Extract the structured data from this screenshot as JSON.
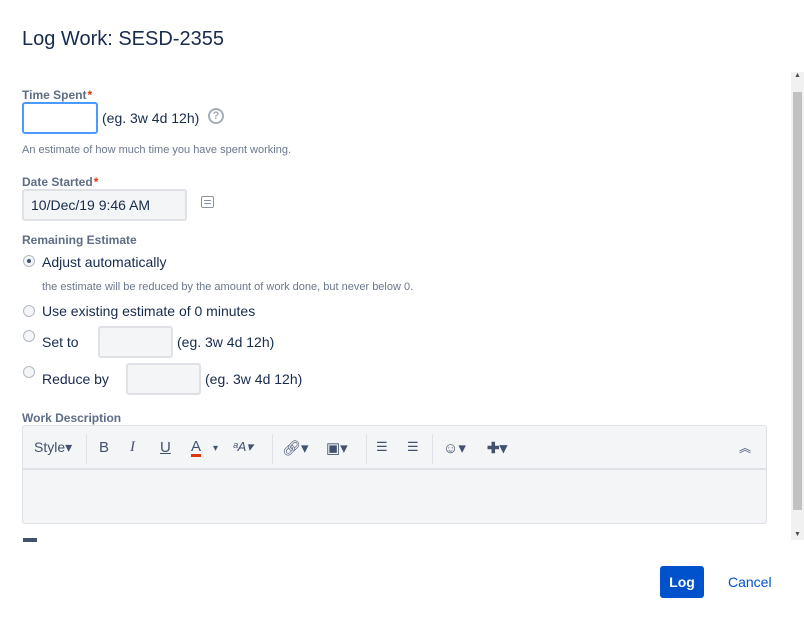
{
  "title": "Log Work: SESD-2355",
  "time_spent": {
    "label": "Time Spent",
    "required": "*",
    "value": "",
    "hint": "(eg. 3w 4d 12h)",
    "help": "An estimate of how much time you have spent working."
  },
  "date_started": {
    "label": "Date Started",
    "required": "*",
    "value": "10/Dec/19 9:46 AM"
  },
  "remaining": {
    "label": "Remaining Estimate",
    "options": [
      {
        "label": "Adjust automatically",
        "selected": true,
        "hint": "the estimate will be reduced by the amount of work done, but never below 0."
      },
      {
        "label": "Use existing estimate of 0 minutes",
        "selected": false
      },
      {
        "label": "Set to",
        "selected": false,
        "hint": "(eg. 3w 4d 12h)"
      },
      {
        "label": "Reduce by",
        "selected": false,
        "hint": "(eg. 3w 4d 12h)"
      }
    ]
  },
  "work_description": {
    "label": "Work Description",
    "toolbar": {
      "style": "Style",
      "bold": "B",
      "italic": "I",
      "underline": "U",
      "color": "A",
      "text_color_accent": "#de350b"
    }
  },
  "buttons": {
    "log": "Log",
    "cancel": "Cancel"
  }
}
